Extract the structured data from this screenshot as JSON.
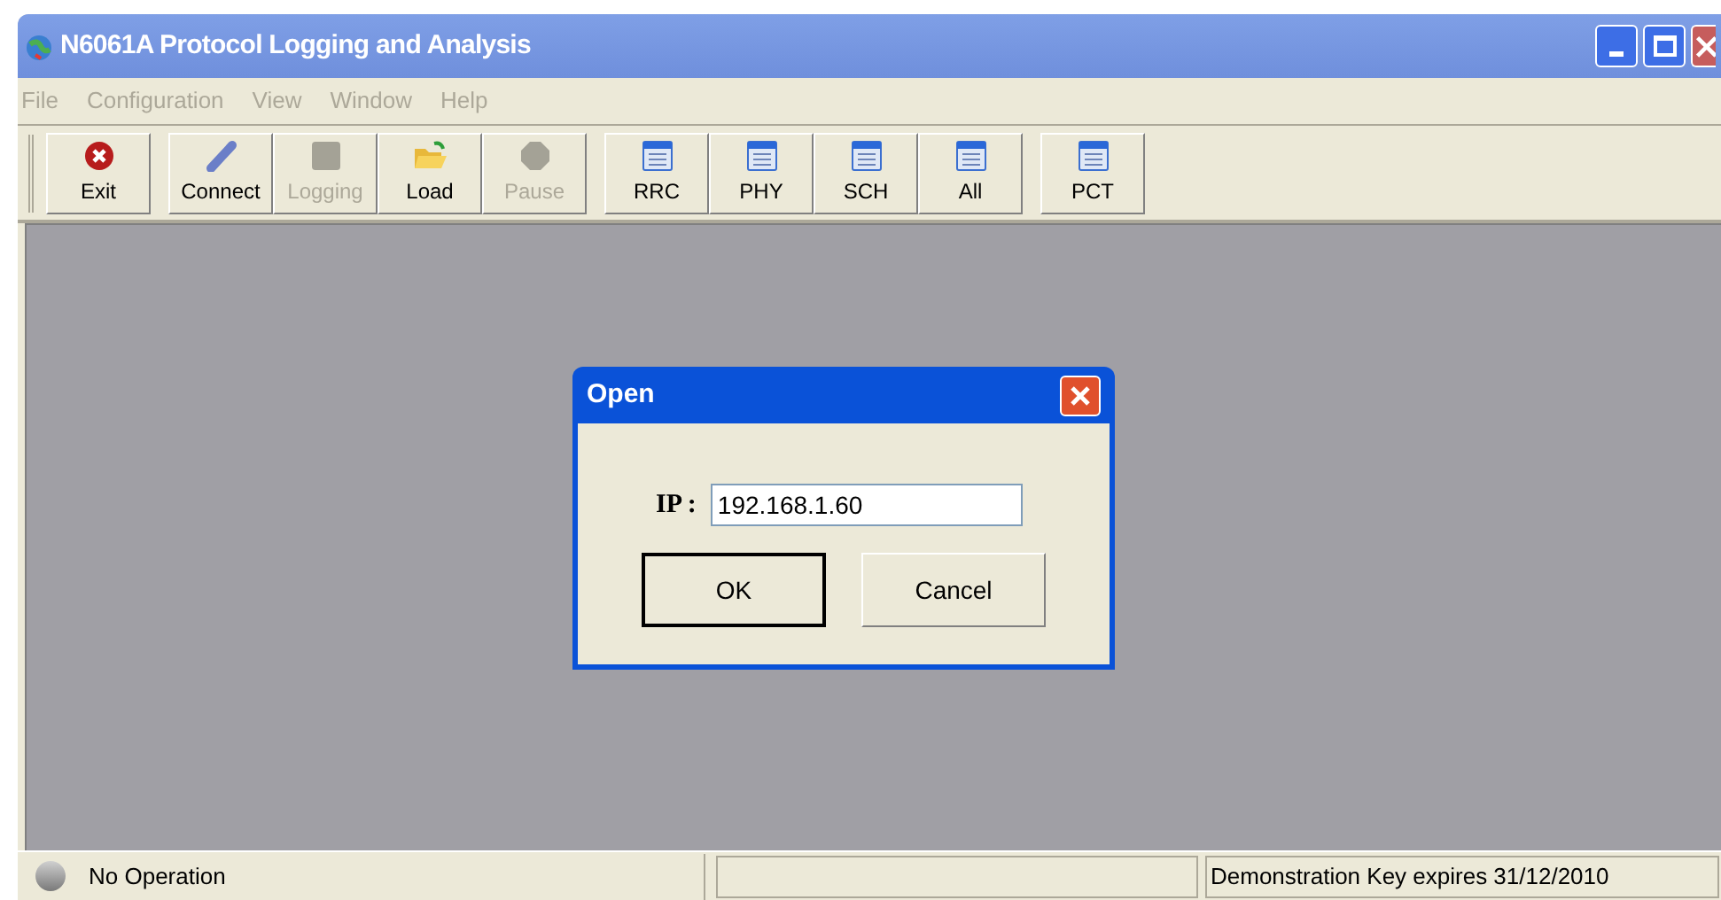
{
  "window": {
    "title": "N6061A Protocol Logging and Analysis"
  },
  "menu": [
    {
      "label": "File",
      "disabled": true
    },
    {
      "label": "Configuration",
      "disabled": true
    },
    {
      "label": "View",
      "disabled": true
    },
    {
      "label": "Window",
      "disabled": true
    },
    {
      "label": "Help",
      "disabled": true
    }
  ],
  "toolbar": [
    {
      "label": "Exit",
      "kind": "exit",
      "disabled": false
    },
    {
      "label": "Connect",
      "kind": "connect",
      "disabled": false
    },
    {
      "label": "Logging",
      "kind": "square",
      "disabled": true
    },
    {
      "label": "Load",
      "kind": "folder",
      "disabled": false
    },
    {
      "label": "Pause",
      "kind": "octagon",
      "disabled": true
    },
    {
      "label": "RRC",
      "kind": "table",
      "disabled": false
    },
    {
      "label": "PHY",
      "kind": "table",
      "disabled": false
    },
    {
      "label": "SCH",
      "kind": "table",
      "disabled": false
    },
    {
      "label": "All",
      "kind": "table",
      "disabled": false
    },
    {
      "label": "PCT",
      "kind": "table",
      "disabled": false
    }
  ],
  "dialog": {
    "title": "Open",
    "ip_label": "IP :",
    "ip_value": "192.168.1.60",
    "buttons": [
      {
        "label": "OK",
        "default": true
      },
      {
        "label": "Cancel",
        "default": false
      }
    ]
  },
  "status_bar": {
    "operation": "No Operation",
    "key_notice": "Demonstration Key expires 31/12/2010"
  }
}
